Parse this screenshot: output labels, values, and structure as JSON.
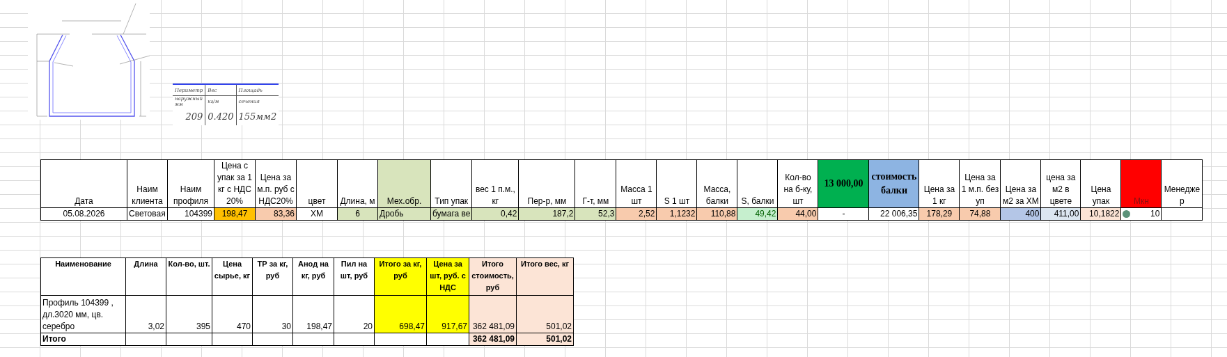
{
  "drawing_table": {
    "rows": [
      [
        "Периметр",
        "Вес",
        "Площадь"
      ],
      [
        "наружный мм",
        "кг/м",
        "сечения"
      ],
      [
        "209",
        "0.420",
        "155мм2"
      ]
    ]
  },
  "spec_table": {
    "columns": [
      {
        "label": "Дата"
      },
      {
        "label": "Наим клиента"
      },
      {
        "label": "Наим профиля"
      },
      {
        "label": "Цена с упак за 1 кг с НДС 20%"
      },
      {
        "label": "Цена за м.п. руб с НДС20%"
      },
      {
        "label": "цвет"
      },
      {
        "label": "Длина, м"
      },
      {
        "label": "Мех.обр.",
        "color": "#d8e4bc"
      },
      {
        "label": "Тип упак"
      },
      {
        "label": "вес 1 п.м., кг"
      },
      {
        "label": "Пер-р, мм"
      },
      {
        "label": "Г-т, мм"
      },
      {
        "label": "Масса 1 шт"
      },
      {
        "label": "S 1 шт"
      },
      {
        "label": "Масса, балки"
      },
      {
        "label": "S, балки"
      },
      {
        "label": "Кол-во на б-ку, шт"
      },
      {
        "label": "13 000,00",
        "color": "#00b050",
        "kind": "big"
      },
      {
        "label": "стоимость балки",
        "color": "#8db4e2",
        "kind": "big"
      },
      {
        "label": "Цена за 1 кг"
      },
      {
        "label": "Цена за 1 м.п. без уп"
      },
      {
        "label": "Цена за м2 за ХМ"
      },
      {
        "label": "цена за м2 в цвете"
      },
      {
        "label": "Цена упак"
      },
      {
        "label": "Мкн",
        "color": "#ff0000",
        "kind": "alert"
      },
      {
        "label": "Менеджер",
        "kind": "break"
      }
    ],
    "row": [
      {
        "text": "05.08.2026"
      },
      {
        "text": "Световая"
      },
      {
        "text": "104399"
      },
      {
        "text": "198,47",
        "color": "#ffc000"
      },
      {
        "text": "83,36",
        "color": "#f8cbad"
      },
      {
        "text": "ХМ"
      },
      {
        "text": "6",
        "color": "#d8e4bc"
      },
      {
        "text": "Дробь",
        "color": "#d8e4bc"
      },
      {
        "text": "бумага ве",
        "color": "#d8e4bc"
      },
      {
        "text": "0,42",
        "color": "#d8e4bc"
      },
      {
        "text": "187,2",
        "color": "#d8e4bc"
      },
      {
        "text": "52,3",
        "color": "#d8e4bc"
      },
      {
        "text": "2,52",
        "color": "#f8cbad"
      },
      {
        "text": "1,1232",
        "color": "#f8cbad"
      },
      {
        "text": "110,88",
        "color": "#f8cbad"
      },
      {
        "text": "49,42",
        "color": "#c6efce",
        "kind": "good"
      },
      {
        "text": "44,00",
        "color": "#f8cbad"
      },
      {
        "text": "-"
      },
      {
        "text": "22 006,35"
      },
      {
        "text": "178,29",
        "color": "#f8cbad"
      },
      {
        "text": "74,88",
        "color": "#f8cbad"
      },
      {
        "text": "400",
        "color": "#b4c6e7"
      },
      {
        "text": "411,00",
        "color": "#dce6f1"
      },
      {
        "text": "10,1822",
        "color": "#fce4d6"
      },
      {
        "text": "10",
        "kind": "indicator",
        "color": "#5b9279"
      }
    ]
  },
  "calc_table": {
    "columns": [
      {
        "label": "Наименование"
      },
      {
        "label": "Длина"
      },
      {
        "label": "Кол-во, шт."
      },
      {
        "label": "Цена сырье, кг"
      },
      {
        "label": "ТР за кг, руб"
      },
      {
        "label": "Анод на кг, руб"
      },
      {
        "label": "Пил на шт, руб"
      },
      {
        "label": "Итого за кг, руб",
        "color": "#ffff00"
      },
      {
        "label": "Цена за шт, руб. с НДС",
        "color": "#ffff00"
      },
      {
        "label": "Итого стоимость, руб",
        "color": "#fce4d6"
      },
      {
        "label": "Итого вес, кг",
        "color": "#fce4d6"
      }
    ],
    "rows": [
      {
        "cells": [
          {
            "text": "Профиль 104399 , дл.3020 мм, цв. серебро"
          },
          {
            "text": "3,02"
          },
          {
            "text": "395"
          },
          {
            "text": "470"
          },
          {
            "text": "30"
          },
          {
            "text": "198,47"
          },
          {
            "text": "20"
          },
          {
            "text": "698,47",
            "color": "#ffff00"
          },
          {
            "text": "917,67",
            "color": "#ffff00"
          },
          {
            "text": "362 481,09",
            "color": "#fce4d6"
          },
          {
            "text": "501,02",
            "color": "#fce4d6"
          }
        ]
      }
    ],
    "total": {
      "cells": [
        {
          "text": "Итого"
        },
        {},
        {},
        {},
        {},
        {},
        {},
        {},
        {},
        {
          "text": "362 481,09",
          "color": "#fce4d6"
        },
        {
          "text": "501,02",
          "color": "#fce4d6"
        }
      ]
    }
  }
}
